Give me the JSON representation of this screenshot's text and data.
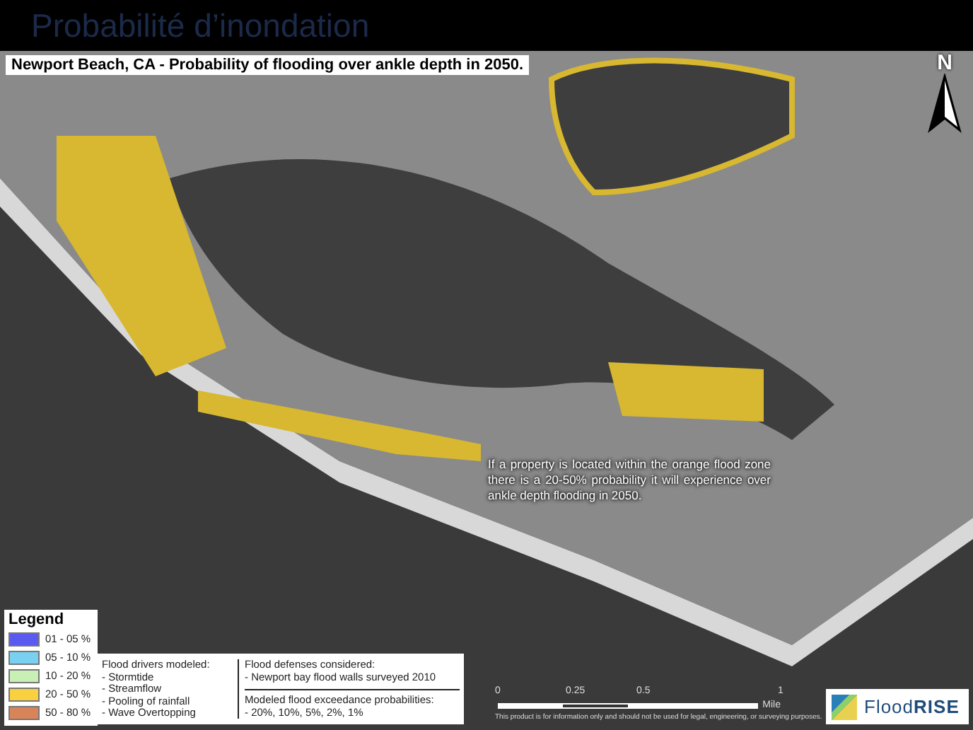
{
  "header": {
    "title": "Probabilité d’inondation"
  },
  "map": {
    "subtitle": "Newport Beach, CA - Probability of flooding over ankle depth in 2050.",
    "annotation": "If a property is located within the orange flood zone there is a 20-50% probability it will experience over ankle depth flooding in 2050.",
    "north_label": "N"
  },
  "legend": {
    "title": "Legend",
    "items": [
      {
        "label": "01 - 05 %",
        "color": "#5a5af0"
      },
      {
        "label": "05 - 10 %",
        "color": "#7ad0f0"
      },
      {
        "label": "10 - 20 %",
        "color": "#c8f0b4"
      },
      {
        "label": "20 - 50 %",
        "color": "#f8d040"
      },
      {
        "label": "50 - 80 %",
        "color": "#d8845a"
      }
    ]
  },
  "info": {
    "drivers": {
      "title": "Flood drivers modeled:",
      "items": [
        "- Stormtide",
        "- Streamflow",
        "- Pooling of rainfall",
        "- Wave Overtopping"
      ]
    },
    "defenses": {
      "title": "Flood defenses considered:",
      "items": [
        "- Newport bay flood walls surveyed 2010"
      ]
    },
    "probabilities": {
      "title": "Modeled flood exceedance probabilities:",
      "items": [
        "- 20%, 10%, 5%, 2%, 1%"
      ]
    }
  },
  "scale_bar": {
    "ticks": [
      "0",
      "0.25",
      "0.5",
      "1"
    ],
    "unit": "Mile"
  },
  "disclaimer": "This product is for information only and should not be used for legal, engineering, or surveying purposes.",
  "logo": {
    "text": "Flood**RISE**"
  }
}
